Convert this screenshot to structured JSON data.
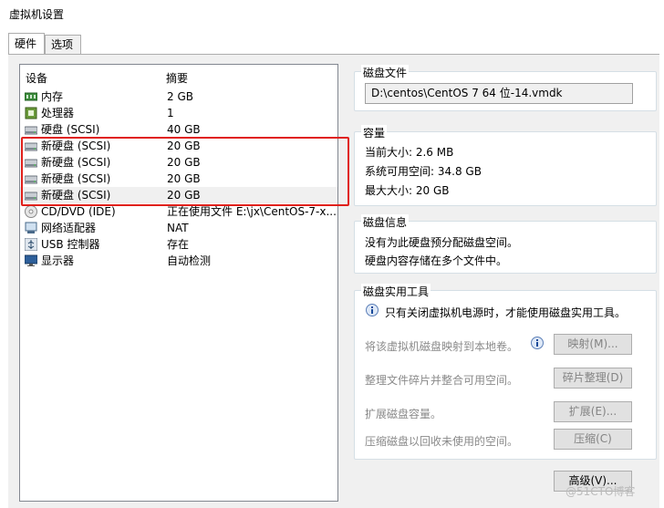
{
  "window": {
    "title": "虚拟机设置"
  },
  "tabs": [
    {
      "label": "硬件"
    },
    {
      "label": "选项"
    }
  ],
  "device_list": {
    "headers": {
      "device": "设备",
      "summary": "摘要"
    },
    "rows": [
      {
        "name": "内存",
        "summary": "2 GB",
        "icon": "memory-icon"
      },
      {
        "name": "处理器",
        "summary": "1",
        "icon": "cpu-icon"
      },
      {
        "name": "硬盘 (SCSI)",
        "summary": "40 GB",
        "icon": "hard-disk-icon"
      },
      {
        "name": "新硬盘 (SCSI)",
        "summary": "20 GB",
        "icon": "hard-disk-icon"
      },
      {
        "name": "新硬盘 (SCSI)",
        "summary": "20 GB",
        "icon": "hard-disk-icon"
      },
      {
        "name": "新硬盘 (SCSI)",
        "summary": "20 GB",
        "icon": "hard-disk-icon"
      },
      {
        "name": "新硬盘 (SCSI)",
        "summary": "20 GB",
        "icon": "hard-disk-icon",
        "selected": true
      },
      {
        "name": "CD/DVD (IDE)",
        "summary": "正在使用文件 E:\\jx\\CentOS-7-x...",
        "icon": "cd-dvd-icon"
      },
      {
        "name": "网络适配器",
        "summary": "NAT",
        "icon": "network-adapter-icon"
      },
      {
        "name": "USB 控制器",
        "summary": "存在",
        "icon": "usb-icon"
      },
      {
        "name": "显示器",
        "summary": "自动检测",
        "icon": "monitor-icon"
      }
    ]
  },
  "disk_file": {
    "title": "磁盘文件",
    "value": "D:\\centos\\CentOS 7 64 位-14.vmdk"
  },
  "capacity": {
    "title": "容量",
    "current": "当前大小: 2.6 MB",
    "available": "系统可用空间: 34.8 GB",
    "max": "最大大小: 20 GB"
  },
  "disk_info": {
    "title": "磁盘信息",
    "line1": "没有为此硬盘预分配磁盘空间。",
    "line2": "硬盘内容存储在多个文件中。"
  },
  "utilities": {
    "title": "磁盘实用工具",
    "notice": "只有关闭虚拟机电源时，才能使用磁盘实用工具。",
    "map_text": "将该虚拟机磁盘映射到本地卷。",
    "map_button": "映射(M)...",
    "defrag_text": "整理文件碎片并整合可用空间。",
    "defrag_button": "碎片整理(D)",
    "expand_text": "扩展磁盘容量。",
    "expand_button": "扩展(E)...",
    "compact_text": "压缩磁盘以回收未使用的空间。",
    "compact_button": "压缩(C)"
  },
  "advanced_button": "高级(V)...",
  "watermark": "@51CTO博客"
}
